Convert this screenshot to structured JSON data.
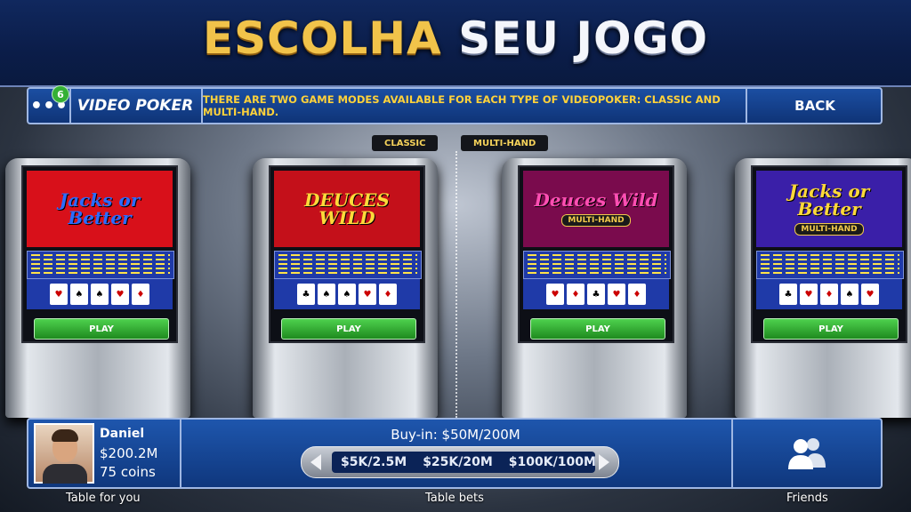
{
  "banner": {
    "title_part1": "ESCOLHA",
    "title_part2": "SEU JOGO"
  },
  "topbar": {
    "menu_icon": "•••",
    "badge_count": "6",
    "section_title": "VIDEO POKER",
    "info": "THERE ARE TWO GAME MODES AVAILABLE FOR EACH TYPE OF VIDEOPOKER: CLASSIC AND MULTI-HAND.",
    "back_label": "BACK"
  },
  "modes": {
    "classic": "CLASSIC",
    "multi": "MULTI-HAND"
  },
  "machines": [
    {
      "title": "Jacks or Better",
      "subtitle": "",
      "play_label": "PLAY",
      "screen_color": "#d8101a",
      "title_color": "#2b6cff"
    },
    {
      "title": "DEUCES WILD",
      "subtitle": "",
      "play_label": "PLAY",
      "screen_color": "#c4101a",
      "title_color": "#ffd93a"
    },
    {
      "title": "Deuces Wild",
      "subtitle": "MULTI-HAND",
      "play_label": "PLAY",
      "screen_color": "#7a0b4d",
      "title_color": "#ff4fb3"
    },
    {
      "title": "Jacks or Better",
      "subtitle": "MULTI-HAND",
      "play_label": "PLAY",
      "screen_color": "#3a1fa8",
      "title_color": "#ffd93a"
    }
  ],
  "player": {
    "name": "Daniel",
    "money": "$200.2M",
    "coins": "75 coins"
  },
  "bets": {
    "buyin": "Buy-in: $50M/200M",
    "options": [
      "$5K/2.5M",
      "$25K/20M",
      "$100K/100M"
    ]
  },
  "labels": {
    "table_for_you": "Table for you",
    "table_bets": "Table bets",
    "friends": "Friends"
  },
  "icons": {
    "menu": "menu-dots-icon",
    "friends": "friends-icon",
    "left": "arrow-left-icon",
    "right": "arrow-right-icon"
  }
}
